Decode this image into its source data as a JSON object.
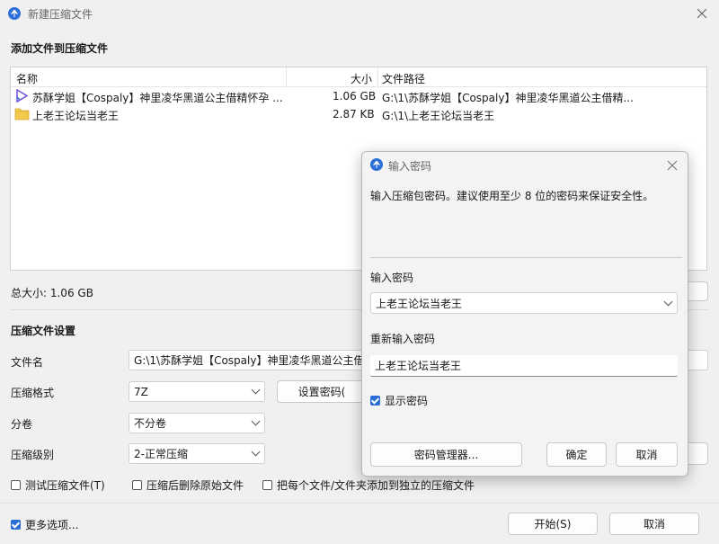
{
  "window": {
    "title": "新建压缩文件",
    "section_add": "添加文件到压缩文件",
    "columns": {
      "name": "名称",
      "size": "大小",
      "path": "文件路径"
    },
    "files": [
      {
        "name": "苏酥学姐【Cospaly】神里凌华黑道公主借精怀孕 ...",
        "size": "1.06 GB",
        "path": "G:\\1\\苏酥学姐【Cospaly】神里凌华黑道公主借精...",
        "icon": "video-file-icon"
      },
      {
        "name": "上老王论坛当老王",
        "size": "2.87 KB",
        "path": "G:\\1\\上老王论坛当老王",
        "icon": "folder-icon"
      }
    ],
    "total_size": "总大小: 1.06 GB",
    "section_settings": "压缩文件设置",
    "filename_label": "文件名",
    "filename_value": "G:\\1\\苏酥学姐【Cospaly】神里凌华黑道公主借精怀孕",
    "format_label": "压缩格式",
    "format_value": "7Z",
    "set_password_button": "设置密码(",
    "split_label": "分卷",
    "split_value": "不分卷",
    "level_label": "压缩级别",
    "level_value": "2-正常压缩",
    "opt_test": "测试压缩文件(T)",
    "opt_delete": "压缩后删除原始文件",
    "opt_each": "把每个文件/文件夹添加到独立的压缩文件",
    "more_options": "更多选项...",
    "start_button": "开始(S)",
    "cancel_button": "取消"
  },
  "dialog": {
    "title": "输入密码",
    "description": "输入压缩包密码。建议使用至少 8 位的密码来保证安全性。",
    "password_label": "输入密码",
    "password_value": "上老王论坛当老王",
    "confirm_label": "重新输入密码",
    "confirm_value": "上老王论坛当老王",
    "show_password": "显示密码",
    "manager_button": "密码管理器...",
    "ok_button": "确定",
    "cancel_button": "取消"
  },
  "colors": {
    "accent": "#2b6fd6",
    "background": "#f0f0f0"
  }
}
